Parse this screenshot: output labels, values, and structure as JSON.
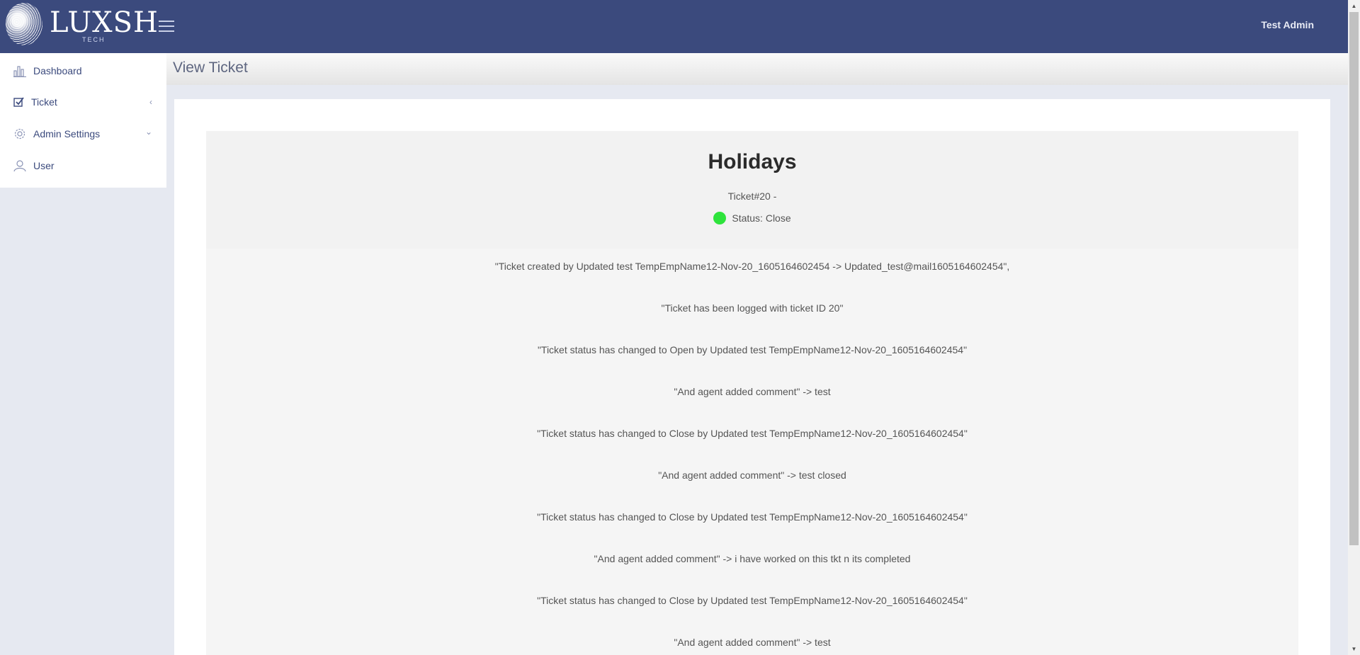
{
  "brand": {
    "name": "LUXSH",
    "sub": "TECH"
  },
  "header": {
    "user": "Test Admin",
    "page_title": "View Ticket"
  },
  "sidebar": {
    "items": [
      {
        "label": "Dashboard",
        "icon": "bar-chart-icon"
      },
      {
        "label": "Ticket",
        "icon": "checkbox-icon",
        "chevron": "‹"
      },
      {
        "label": "Admin Settings",
        "icon": "gear-icon",
        "chevron": "⌄"
      },
      {
        "label": "User",
        "icon": "user-icon"
      }
    ]
  },
  "ticket": {
    "title": "Holidays",
    "number": "Ticket#20 -",
    "status": "Status: Close",
    "status_color": "#2ee33c",
    "log": [
      "\"Ticket created by Updated test TempEmpName12-Nov-20_1605164602454 -> Updated_test@mail1605164602454\",",
      "\"Ticket has been logged with ticket ID 20\"",
      "\"Ticket status has changed to Open by Updated test TempEmpName12-Nov-20_1605164602454\"",
      "\"And agent added comment\" -> test",
      "\"Ticket status has changed to Close by Updated test TempEmpName12-Nov-20_1605164602454\"",
      "\"And agent added comment\" -> test closed",
      "\"Ticket status has changed to Close by Updated test TempEmpName12-Nov-20_1605164602454\"",
      "\"And agent added comment\" -> i have worked on this tkt n its completed",
      "\"Ticket status has changed to Close by Updated test TempEmpName12-Nov-20_1605164602454\"",
      "\"And agent added comment\" -> test"
    ]
  },
  "colors": {
    "topbar": "#3b4a7d",
    "accent": "#3b4a7d"
  }
}
